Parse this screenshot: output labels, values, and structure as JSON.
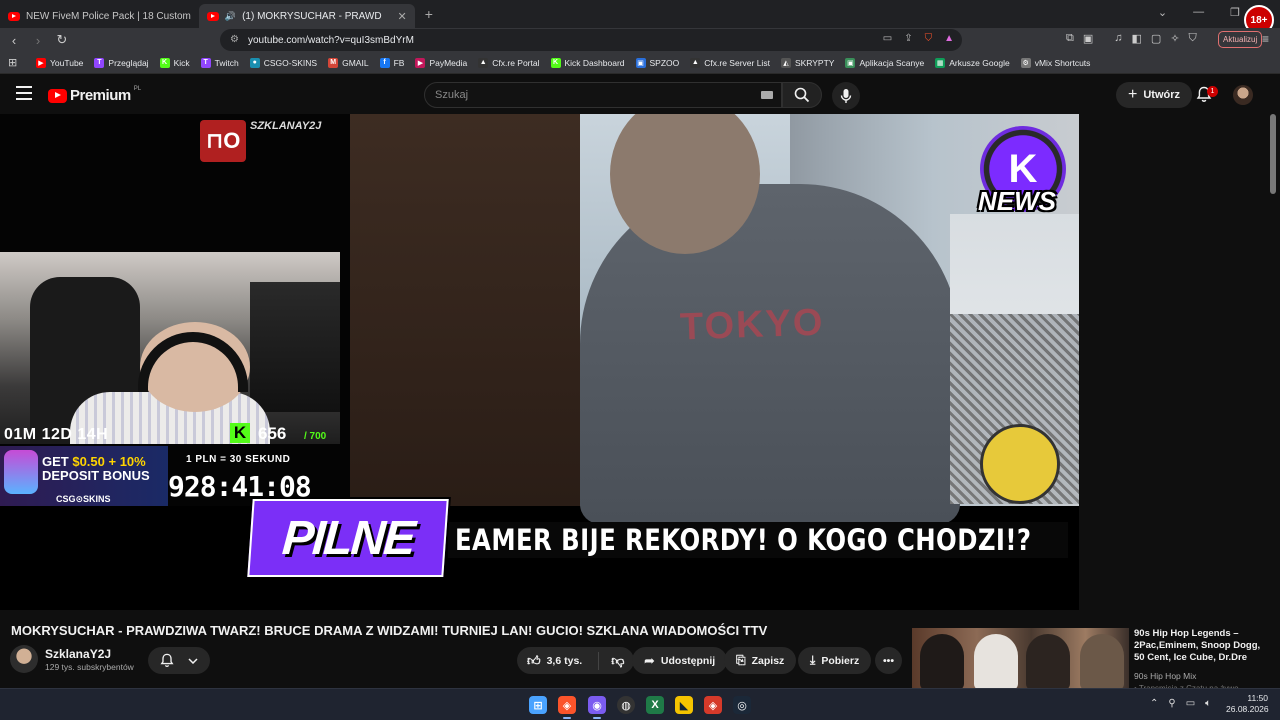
{
  "browser": {
    "tabs": [
      {
        "label": "NEW FiveM Police Pack | 18 Custom"
      },
      {
        "label": "(1) MOKRYSUCHAR - PRAWD"
      }
    ],
    "url": "youtube.com/watch?v=quI3smBdYrM",
    "update_label": "Aktualizuj",
    "badge": "18+",
    "bookmarks": [
      {
        "label": "YouTube",
        "color": "#ff0000",
        "glyph": "▶"
      },
      {
        "label": "Przeglądaj",
        "color": "#9146ff",
        "glyph": "T"
      },
      {
        "label": "Kick",
        "color": "#53fc18",
        "glyph": "K"
      },
      {
        "label": "Twitch",
        "color": "#9146ff",
        "glyph": "T"
      },
      {
        "label": "CSGO-SKINS",
        "color": "#1a8fb0",
        "glyph": "●"
      },
      {
        "label": "GMAIL",
        "color": "#d44638",
        "glyph": "M"
      },
      {
        "label": "FB",
        "color": "#1877f2",
        "glyph": "f"
      },
      {
        "label": "PayMedia",
        "color": "#c2185b",
        "glyph": "▶"
      },
      {
        "label": "Cfx.re Portal",
        "color": "#333333",
        "glyph": "▲"
      },
      {
        "label": "Kick Dashboard",
        "color": "#53fc18",
        "glyph": "K"
      },
      {
        "label": "SPZOO",
        "color": "#2a6fdb",
        "glyph": "▣"
      },
      {
        "label": "Cfx.re Server List",
        "color": "#333333",
        "glyph": "▲"
      },
      {
        "label": "SKRYPTY",
        "color": "#555555",
        "glyph": "◭"
      },
      {
        "label": "Aplikacja Scanye",
        "color": "#3a8f5a",
        "glyph": "▣"
      },
      {
        "label": "Arkusze Google",
        "color": "#0f9d58",
        "glyph": "▦"
      },
      {
        "label": "vMix Shortcuts",
        "color": "#777777",
        "glyph": "⚙"
      }
    ]
  },
  "youtube": {
    "logo_text": "Premium",
    "region": "PL",
    "search_placeholder": "Szukaj",
    "create_label": "Utwórz",
    "notification_count": "1"
  },
  "video": {
    "overlay": {
      "channel_watermark": "SZKLANAY2J",
      "news_logo": "NEWS",
      "countdown": "01M 12D 14H",
      "kick_subs": "656",
      "kick_subs_goal": "/ 700",
      "promo_line1_a": "GET ",
      "promo_line1_b": "$0.50 + 10%",
      "promo_line2": "DEPOSIT BONUS",
      "promo_brand": "CSG⊙SKINS",
      "rate": "1 PLN = 30 SEKUND",
      "timer": "928:41:08",
      "breaking_label": "PILNE",
      "ticker": "EAMER BIJE REKORDY! O KOGO CHODZI!?",
      "hoodie_text": "TOKYO"
    },
    "title": "MOKRYSUCHAR - PRAWDZIWA TWARZ! BRUCE DRAMA Z WIDZAMI! TURNIEJ LAN! GUCIO! SZKLANA WIADOMOŚCI TTV",
    "channel": {
      "name": "SzklanaY2J",
      "subscribers": "129 tys. subskrybentów"
    },
    "actions": {
      "likes": "3,6 tys.",
      "share": "Udostępnij",
      "save": "Zapisz",
      "download": "Pobierz"
    }
  },
  "recommendation": {
    "title": "90s Hip Hop Legends – 2Pac,Eminem, Snoop Dogg, 50 Cent, Ice Cube, Dr.Dre",
    "channel": "90s Hip Hop Mix",
    "meta": "• Transmisja z Czatu na żywo"
  },
  "taskbar": {
    "time": "11:50",
    "date": "26.08.2026"
  }
}
